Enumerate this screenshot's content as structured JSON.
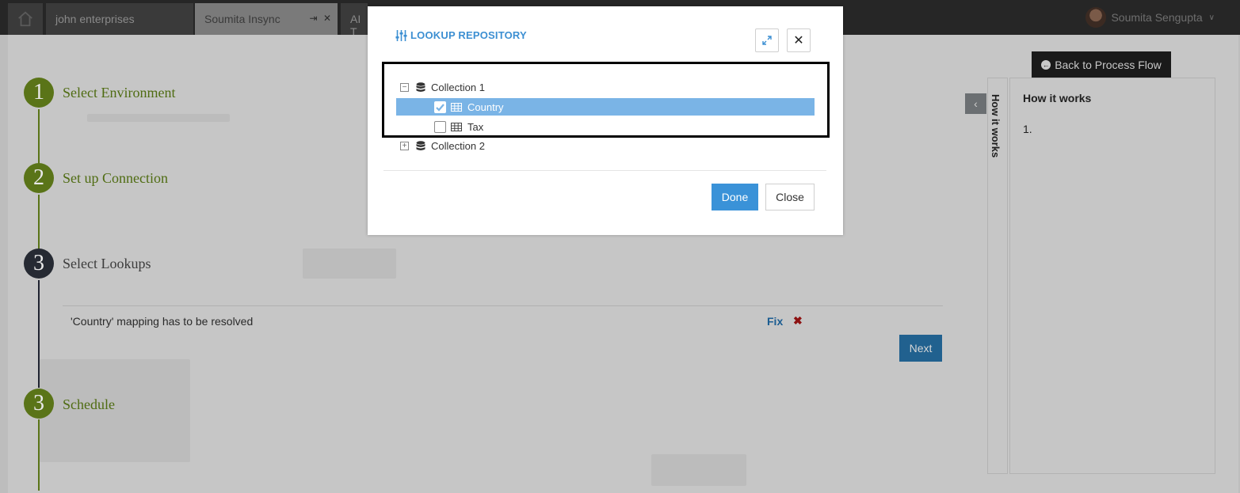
{
  "topbar": {
    "tabs": [
      {
        "label": "john enterprises"
      },
      {
        "label": "Soumita Insync"
      },
      {
        "label": "AI T"
      }
    ],
    "user_name": "Soumita Sengupta"
  },
  "steps": [
    {
      "number": "1",
      "label": "Select Environment",
      "state": "complete"
    },
    {
      "number": "2",
      "label": "Set up Connection",
      "state": "complete"
    },
    {
      "number": "3",
      "label": "Select Lookups",
      "state": "current"
    },
    {
      "number": "3",
      "label": "Schedule",
      "state": "complete"
    }
  ],
  "lookup_status": {
    "message": "'Country' mapping has to be resolved",
    "fix_label": "Fix"
  },
  "next_label": "Next",
  "back_label": "Back to Process Flow",
  "how_it_works": {
    "tab_label": "How it works",
    "title": "How it works",
    "items": [
      "1."
    ]
  },
  "modal": {
    "title": "LOOKUP REPOSITORY",
    "tree": [
      {
        "label": "Collection 1",
        "expanded": true,
        "children": [
          {
            "label": "Country",
            "checked": true,
            "selected": true
          },
          {
            "label": "Tax",
            "checked": false,
            "selected": false
          }
        ]
      },
      {
        "label": "Collection 2",
        "expanded": false
      }
    ],
    "done_label": "Done",
    "close_label": "Close"
  },
  "colors": {
    "accent_blue": "#3a92d8",
    "selected_row": "#7ab4e6",
    "step_green": "#5a7418",
    "step_dark": "#262a33"
  }
}
